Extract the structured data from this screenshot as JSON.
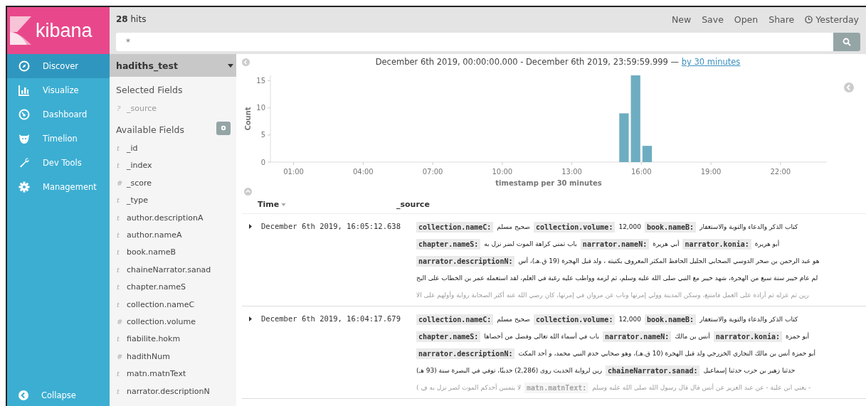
{
  "logo": {
    "text": "kibana"
  },
  "nav": [
    {
      "label": "Discover",
      "selected": true
    },
    {
      "label": "Visualize",
      "selected": false
    },
    {
      "label": "Dashboard",
      "selected": false
    },
    {
      "label": "Timelion",
      "selected": false
    },
    {
      "label": "Dev Tools",
      "selected": false
    },
    {
      "label": "Management",
      "selected": false
    }
  ],
  "collapse": {
    "label": "Collapse"
  },
  "hits": {
    "count": "28",
    "label": "hits"
  },
  "top_links": [
    {
      "label": "New"
    },
    {
      "label": "Save"
    },
    {
      "label": "Open"
    },
    {
      "label": "Share"
    },
    {
      "label": "Yesterday",
      "kind": "time"
    }
  ],
  "search": {
    "value": "*"
  },
  "index_pattern": {
    "name": "hadiths_test"
  },
  "selected_fields": {
    "title": "Selected Fields",
    "items": [
      {
        "type": "?",
        "name": "_source"
      }
    ]
  },
  "available_fields": {
    "title": "Available Fields",
    "items": [
      {
        "type": "t",
        "name": "_id"
      },
      {
        "type": "t",
        "name": "_index"
      },
      {
        "type": "#",
        "name": "_score"
      },
      {
        "type": "t",
        "name": "_type"
      },
      {
        "type": "t",
        "name": "author.descriptionA"
      },
      {
        "type": "t",
        "name": "author.nameA"
      },
      {
        "type": "t",
        "name": "book.nameB"
      },
      {
        "type": "t",
        "name": "chaineNarrator.sanad"
      },
      {
        "type": "t",
        "name": "chapter.nameS"
      },
      {
        "type": "t",
        "name": "collection.nameC"
      },
      {
        "type": "#",
        "name": "collection.volume"
      },
      {
        "type": "t",
        "name": "fiabilite.hokm"
      },
      {
        "type": "#",
        "name": "hadithNum"
      },
      {
        "type": "t",
        "name": "matn.matnText"
      },
      {
        "type": "t",
        "name": "narrator.descriptionN"
      }
    ]
  },
  "time_range": {
    "text": "December 6th 2019, 00:00:00.000 - December 6th 2019, 23:59:59.999 —",
    "interval_link": "by 30 minutes"
  },
  "histogram": {
    "chart_data": {
      "type": "bar",
      "ylabel": "Count",
      "xlabel": "timestamp per 30 minutes",
      "x": [
        15.25,
        15.75,
        16.25
      ],
      "values": [
        9,
        16,
        3
      ],
      "xlim": [
        0,
        24
      ],
      "ylim": [
        0,
        16
      ],
      "yticks": [
        0,
        5,
        10,
        15
      ],
      "xticks": [
        {
          "value": 1,
          "label": "01:00"
        },
        {
          "value": 4,
          "label": "04:00"
        },
        {
          "value": 7,
          "label": "07:00"
        },
        {
          "value": 10,
          "label": "10:00"
        },
        {
          "value": 13,
          "label": "13:00"
        },
        {
          "value": 16,
          "label": "16:00"
        },
        {
          "value": 19,
          "label": "19:00"
        },
        {
          "value": 22,
          "label": "22:00"
        }
      ]
    }
  },
  "table": {
    "columns": [
      {
        "label": "Time",
        "sorted": true
      },
      {
        "label": "_source",
        "sorted": false
      }
    ],
    "rows": [
      {
        "time": "December 6th 2019, 16:05:12.638",
        "expanded": false,
        "lines": [
          [
            {
              "kind": "key",
              "text": "collection.nameC:"
            },
            {
              "kind": "text",
              "text": "صحيح مسلم"
            },
            {
              "kind": "key",
              "text": "collection.volume:"
            },
            {
              "kind": "text",
              "text": "12,000"
            },
            {
              "kind": "key",
              "text": "book.nameB:"
            },
            {
              "kind": "text",
              "text": "كتاب الذكر والدعاء والتوبة والاستغفار"
            }
          ],
          [
            {
              "kind": "key",
              "text": "chapter.nameS:"
            },
            {
              "kind": "text",
              "text": "باب تمني كراهة الموت لضر نزل به"
            },
            {
              "kind": "key",
              "text": "narrator.nameN:"
            },
            {
              "kind": "text",
              "text": "أبي هريرة"
            },
            {
              "kind": "key",
              "text": "narrator.konia:"
            },
            {
              "kind": "text",
              "text": "أبو هريرة"
            }
          ],
          [
            {
              "kind": "key",
              "text": "narrator.descriptionN:"
            },
            {
              "kind": "text",
              "text": "هو عبد الرحمن بن صخر الدوسي الصحابي الجليل الحافظ المكثر المعروف بكنيته ، ولد قبل الهجرة (19 ق.هـ)، أس"
            }
          ],
          [
            {
              "kind": "text",
              "text": "لم عام خيبر سنة سبع من الهجرة، شهد خيبر مع النبي صلى الله عليه وسلم، ثم لزمه وواظب عليه رغبة في العلم، لقد استعمله عمر بن الخطاب على البح"
            }
          ],
          [
            {
              "kind": "text",
              "text": "رين ثم عزله ثم أراده على العمل فامتنع، وسكن المدينة وولي إمرتها وناب عن مروان في إمرتها، كان رضي الله عنه أكثر الصحابة رواية وأولهم على الا"
            }
          ]
        ]
      },
      {
        "time": "December 6th 2019, 16:04:17.679",
        "expanded": false,
        "lines": [
          [
            {
              "kind": "key",
              "text": "collection.nameC:"
            },
            {
              "kind": "text",
              "text": "صحيح مسلم"
            },
            {
              "kind": "key",
              "text": "collection.volume:"
            },
            {
              "kind": "text",
              "text": "12,000"
            },
            {
              "kind": "key",
              "text": "book.nameB:"
            },
            {
              "kind": "text",
              "text": "كتاب الذكر والدعاء والتوبة والاستغفار"
            }
          ],
          [
            {
              "kind": "key",
              "text": "chapter.nameS:"
            },
            {
              "kind": "text",
              "text": "باب في أسماء الله تعالى وفضل من أحصاها"
            },
            {
              "kind": "key",
              "text": "narrator.nameN:"
            },
            {
              "kind": "text",
              "text": "أنس بن مالك"
            },
            {
              "kind": "key",
              "text": "narrator.konia:"
            },
            {
              "kind": "text",
              "text": "أبو حمزة"
            }
          ],
          [
            {
              "kind": "key",
              "text": "narrator.descriptionN:"
            },
            {
              "kind": "text",
              "text": "أبو حمزة أنس بن مالك النجاري الخزرجي ولد قبل الهجرة (10 ق.هـ)، وهو صحابي خدم النبي محمد، و أحد المكث"
            }
          ],
          [
            {
              "kind": "text",
              "text": "حدثنا زهير بن حرب حدثنا إسماعيل"
            },
            {
              "kind": "key",
              "text": "chaineNarrator.sanad:"
            },
            {
              "kind": "text",
              "text": "رين لرواية الحديث روى (2,286) حديثًا، توفي في البصرة سنة (93 هـ)"
            }
          ],
          [
            {
              "kind": "text",
              "text": "- يعني ابن علية - عن عبد العزيز عن أنس قال قال رسول الله صلى الله عليه وسلم"
            },
            {
              "kind": "key",
              "text": "matn.matnText:"
            },
            {
              "kind": "text",
              "text": "لا يتمنين أحدكم الموت لضر نزل به ف )"
            }
          ]
        ]
      }
    ]
  }
}
